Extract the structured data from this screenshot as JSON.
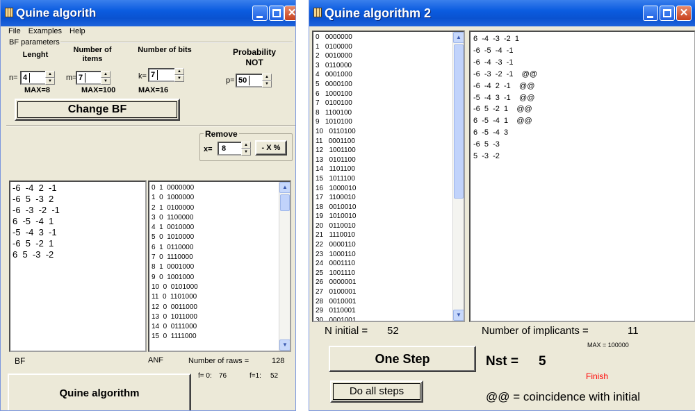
{
  "win1": {
    "title": "Quine algorith",
    "menu": [
      "File",
      "Examples",
      "Help"
    ],
    "bf_params_label": "BF parameters",
    "length": {
      "label": "Lenght",
      "prefix": "n=",
      "value": "4",
      "max": "MAX=8"
    },
    "items": {
      "label": "Number of items",
      "prefix": "m=",
      "value": "7",
      "max": "MAX=100"
    },
    "bits": {
      "label": "Number of bits",
      "prefix": "k=",
      "value": "7",
      "max": "MAX=16"
    },
    "prob": {
      "label": "Probability NOT",
      "prefix": "p=",
      "value": "50"
    },
    "change_bf_button": "Change BF",
    "remove": {
      "label": "Remove",
      "prefix": "x=",
      "value": "8",
      "button": "- X %"
    },
    "bf_list": [
      "-6  -4  2  -1",
      "-6  5  -3  2",
      "-6  -3  -2  -1",
      "6  -5  -4  1",
      "-5  -4  3  -1",
      "-6  5  -2  1",
      "6  5  -3  -2"
    ],
    "anf_list": [
      "0  1  0000000",
      "1  0  1000000",
      "2  1  0100000",
      "3  0  1100000",
      "4  1  0010000",
      "5  0  1010000",
      "6  1  0110000",
      "7  0  1110000",
      "8  1  0001000",
      "9  0  1001000",
      "10  0  0101000",
      "11  0  1101000",
      "12  0  0011000",
      "13  0  1011000",
      "14  0  0111000",
      "15  0  1111000"
    ],
    "bf_label": "BF",
    "anf_label": "ANF",
    "rows_label": "Number of raws =",
    "rows_value": "128",
    "f0_label": "f= 0:",
    "f0_value": "76",
    "f1_label": "f=1:",
    "f1_value": "52",
    "quine_button": "Quine algorithm"
  },
  "win2": {
    "title": "Quine algorithm 2",
    "initial_list": [
      "0   0000000",
      "1   0100000",
      "2   0010000",
      "3   0110000",
      "4   0001000",
      "5   0000100",
      "6   1000100",
      "7   0100100",
      "8   1100100",
      "9   1010100",
      "10   0110100",
      "11   0001100",
      "12   1001100",
      "13   0101100",
      "14   1101100",
      "15   1011100",
      "16   1000010",
      "17   1100010",
      "18   0010010",
      "19   1010010",
      "20   0110010",
      "21   1110010",
      "22   0000110",
      "23   1000110",
      "24   0001110",
      "25   1001110",
      "26   0000001",
      "27   0100001",
      "28   0010001",
      "29   0110001",
      "30   0001001"
    ],
    "implicants_list": [
      "6  -4  -3  -2  1",
      "-6  -5  -4  -1",
      "-6  -4  -3  -1",
      "-6  -3  -2  -1    @@",
      "-6  -4  2  -1    @@",
      "-5  -4  3  -1    @@",
      "-6  5  -2  1    @@",
      "6  -5  -4  1    @@",
      "6  -5  -4  3",
      "-6  5  -3",
      "5  -3  -2"
    ],
    "n_initial_label": "N initial =",
    "n_initial_value": "52",
    "num_implicants_label": "Number of implicants =",
    "num_implicants_value": "11",
    "max_label": "MAX = 100000",
    "one_step_button": "One Step",
    "nst_label": "Nst =",
    "nst_value": "5",
    "finish_label": "Finish",
    "finish_color": "#ff0000",
    "do_all_button": "Do all steps",
    "legend": "@@ = coincidence with initial"
  }
}
